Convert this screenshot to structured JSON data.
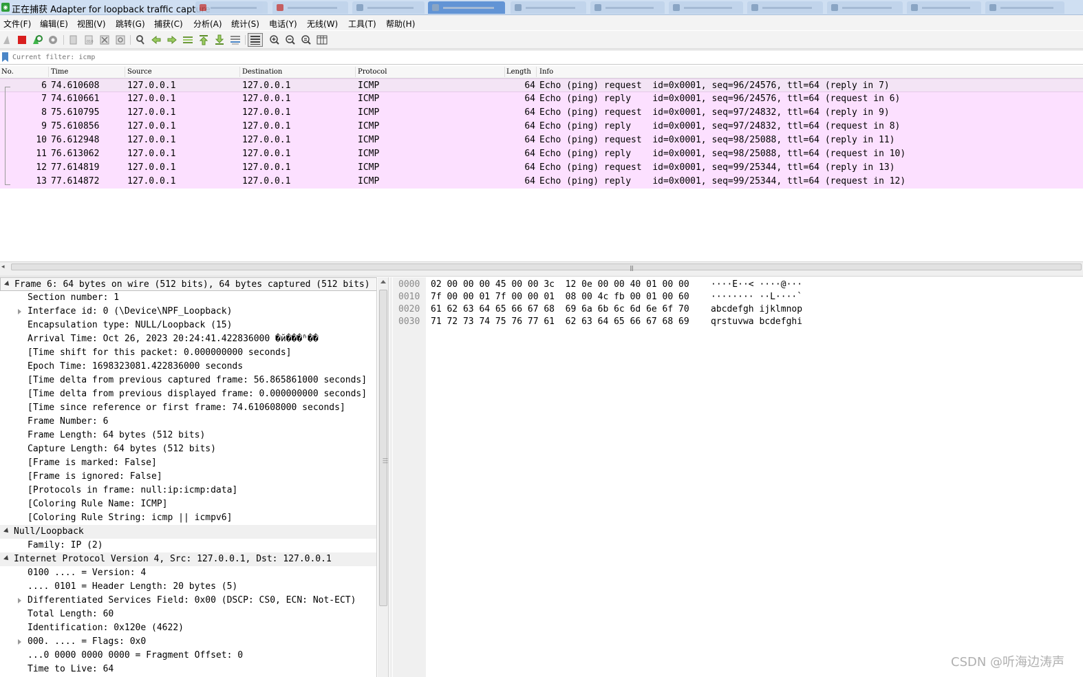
{
  "window": {
    "title": "正在捕获 Adapter for loopback traffic capture"
  },
  "menu": [
    "文件(F)",
    "编辑(E)",
    "视图(V)",
    "跳转(G)",
    "捕获(C)",
    "分析(A)",
    "统计(S)",
    "电话(Y)",
    "无线(W)",
    "工具(T)",
    "帮助(H)"
  ],
  "toolbar": {
    "icons": [
      "shark-fin-start-icon",
      "stop-capture-icon",
      "restart-capture-icon",
      "capture-options-icon",
      "open-file-icon",
      "save-file-icon",
      "close-file-icon",
      "reload-file-icon",
      "find-packet-icon",
      "go-back-icon",
      "go-forward-icon",
      "go-to-packet-icon",
      "go-first-icon",
      "go-last-icon",
      "auto-scroll-icon",
      "colorize-icon",
      "zoom-in-icon",
      "zoom-out-icon",
      "zoom-normal-icon",
      "resize-columns-icon"
    ]
  },
  "filter": {
    "placeholder": "Current filter: icmp"
  },
  "packet_list": {
    "columns": [
      "No.",
      "Time",
      "Source",
      "Destination",
      "Protocol",
      "Length",
      "Info"
    ],
    "rows": [
      {
        "no": "6",
        "time": "74.610608",
        "source": "127.0.0.1",
        "destination": "127.0.0.1",
        "protocol": "ICMP",
        "length": "64",
        "info": "Echo (ping) request  id=0x0001, seq=96/24576, ttl=64 (reply in 7)"
      },
      {
        "no": "7",
        "time": "74.610661",
        "source": "127.0.0.1",
        "destination": "127.0.0.1",
        "protocol": "ICMP",
        "length": "64",
        "info": "Echo (ping) reply    id=0x0001, seq=96/24576, ttl=64 (request in 6)"
      },
      {
        "no": "8",
        "time": "75.610795",
        "source": "127.0.0.1",
        "destination": "127.0.0.1",
        "protocol": "ICMP",
        "length": "64",
        "info": "Echo (ping) request  id=0x0001, seq=97/24832, ttl=64 (reply in 9)"
      },
      {
        "no": "9",
        "time": "75.610856",
        "source": "127.0.0.1",
        "destination": "127.0.0.1",
        "protocol": "ICMP",
        "length": "64",
        "info": "Echo (ping) reply    id=0x0001, seq=97/24832, ttl=64 (request in 8)"
      },
      {
        "no": "10",
        "time": "76.612948",
        "source": "127.0.0.1",
        "destination": "127.0.0.1",
        "protocol": "ICMP",
        "length": "64",
        "info": "Echo (ping) request  id=0x0001, seq=98/25088, ttl=64 (reply in 11)"
      },
      {
        "no": "11",
        "time": "76.613062",
        "source": "127.0.0.1",
        "destination": "127.0.0.1",
        "protocol": "ICMP",
        "length": "64",
        "info": "Echo (ping) reply    id=0x0001, seq=98/25088, ttl=64 (request in 10)"
      },
      {
        "no": "12",
        "time": "77.614819",
        "source": "127.0.0.1",
        "destination": "127.0.0.1",
        "protocol": "ICMP",
        "length": "64",
        "info": "Echo (ping) request  id=0x0001, seq=99/25344, ttl=64 (reply in 13)"
      },
      {
        "no": "13",
        "time": "77.614872",
        "source": "127.0.0.1",
        "destination": "127.0.0.1",
        "protocol": "ICMP",
        "length": "64",
        "info": "Echo (ping) reply    id=0x0001, seq=99/25344, ttl=64 (request in 12)"
      }
    ],
    "row_color": "#fce0ff",
    "selected_row": "6"
  },
  "details": {
    "lines": [
      {
        "text": "Frame 6: 64 bytes on wire (512 bits), 64 bytes captured (512 bits)",
        "indent": 0,
        "expander": "expanded",
        "header": true
      },
      {
        "text": "Section number: 1",
        "indent": 1,
        "expander": "none",
        "header": false
      },
      {
        "text": "Interface id: 0 (\\Device\\NPF_Loopback)",
        "indent": 1,
        "expander": "collapsed",
        "header": false
      },
      {
        "text": "Encapsulation type: NULL/Loopback (15)",
        "indent": 1,
        "expander": "none",
        "header": false
      },
      {
        "text": "Arrival Time: Oct 26, 2023 20:24:41.422836000 �й���ʱ��",
        "indent": 1,
        "expander": "none",
        "header": false
      },
      {
        "text": "[Time shift for this packet: 0.000000000 seconds]",
        "indent": 1,
        "expander": "none",
        "header": false
      },
      {
        "text": "Epoch Time: 1698323081.422836000 seconds",
        "indent": 1,
        "expander": "none",
        "header": false
      },
      {
        "text": "[Time delta from previous captured frame: 56.865861000 seconds]",
        "indent": 1,
        "expander": "none",
        "header": false
      },
      {
        "text": "[Time delta from previous displayed frame: 0.000000000 seconds]",
        "indent": 1,
        "expander": "none",
        "header": false
      },
      {
        "text": "[Time since reference or first frame: 74.610608000 seconds]",
        "indent": 1,
        "expander": "none",
        "header": false
      },
      {
        "text": "Frame Number: 6",
        "indent": 1,
        "expander": "none",
        "header": false
      },
      {
        "text": "Frame Length: 64 bytes (512 bits)",
        "indent": 1,
        "expander": "none",
        "header": false
      },
      {
        "text": "Capture Length: 64 bytes (512 bits)",
        "indent": 1,
        "expander": "none",
        "header": false
      },
      {
        "text": "[Frame is marked: False]",
        "indent": 1,
        "expander": "none",
        "header": false
      },
      {
        "text": "[Frame is ignored: False]",
        "indent": 1,
        "expander": "none",
        "header": false
      },
      {
        "text": "[Protocols in frame: null:ip:icmp:data]",
        "indent": 1,
        "expander": "none",
        "header": false
      },
      {
        "text": "[Coloring Rule Name: ICMP]",
        "indent": 1,
        "expander": "none",
        "header": false
      },
      {
        "text": "[Coloring Rule String: icmp || icmpv6]",
        "indent": 1,
        "expander": "none",
        "header": false
      },
      {
        "text": "Null/Loopback",
        "indent": 0,
        "expander": "expanded",
        "header": true
      },
      {
        "text": "Family: IP (2)",
        "indent": 1,
        "expander": "none",
        "header": false
      },
      {
        "text": "Internet Protocol Version 4, Src: 127.0.0.1, Dst: 127.0.0.1",
        "indent": 0,
        "expander": "expanded",
        "header": true
      },
      {
        "text": "0100 .... = Version: 4",
        "indent": 1,
        "expander": "none",
        "header": false
      },
      {
        "text": ".... 0101 = Header Length: 20 bytes (5)",
        "indent": 1,
        "expander": "none",
        "header": false
      },
      {
        "text": "Differentiated Services Field: 0x00 (DSCP: CS0, ECN: Not-ECT)",
        "indent": 1,
        "expander": "collapsed",
        "header": false
      },
      {
        "text": "Total Length: 60",
        "indent": 1,
        "expander": "none",
        "header": false
      },
      {
        "text": "Identification: 0x120e (4622)",
        "indent": 1,
        "expander": "none",
        "header": false
      },
      {
        "text": "000. .... = Flags: 0x0",
        "indent": 1,
        "expander": "collapsed",
        "header": false
      },
      {
        "text": "...0 0000 0000 0000 = Fragment Offset: 0",
        "indent": 1,
        "expander": "none",
        "header": false
      },
      {
        "text": "Time to Live: 64",
        "indent": 1,
        "expander": "none",
        "header": false
      }
    ]
  },
  "bytes": {
    "rows": [
      {
        "offset": "0000",
        "hex": "02 00 00 00 45 00 00 3c  12 0e 00 00 40 01 00 00",
        "ascii": "····E··< ····@···"
      },
      {
        "offset": "0010",
        "hex": "7f 00 00 01 7f 00 00 01  08 00 4c fb 00 01 00 60",
        "ascii": "········ ··L····`"
      },
      {
        "offset": "0020",
        "hex": "61 62 63 64 65 66 67 68  69 6a 6b 6c 6d 6e 6f 70",
        "ascii": "abcdefgh ijklmnop"
      },
      {
        "offset": "0030",
        "hex": "71 72 73 74 75 76 77 61  62 63 64 65 66 67 68 69",
        "ascii": "qrstuvwa bcdefghi"
      }
    ]
  },
  "watermark": "CSDN @听海边涛声"
}
